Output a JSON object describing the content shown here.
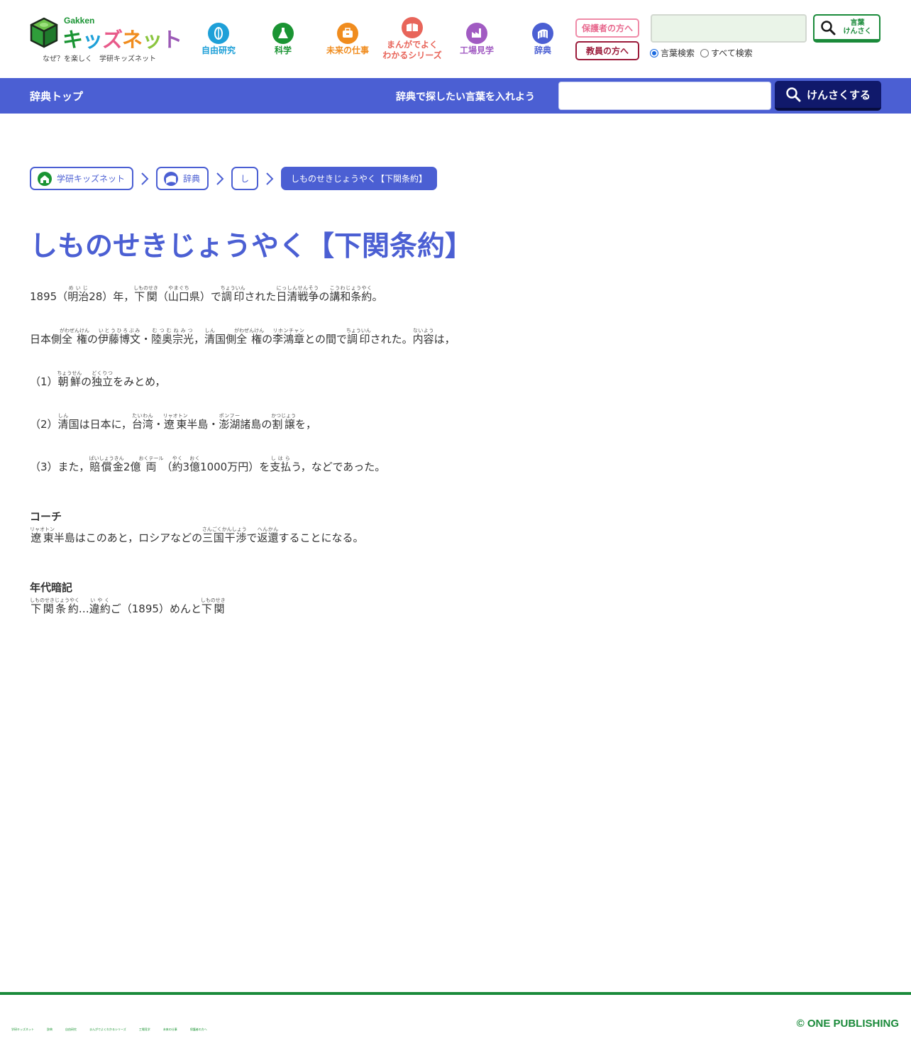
{
  "logo": {
    "brand": "Gakken",
    "name_parts": [
      "キ",
      "ッ",
      "ズ",
      "ネ",
      "ッ",
      "ト"
    ],
    "tagline": "なぜ？を楽しく　学研キッズネット"
  },
  "categories": [
    {
      "label": "自由研究",
      "icon": "magnifier-leaf-icon",
      "color": "#1ea0d8"
    },
    {
      "label": "科学",
      "icon": "flask-icon",
      "color": "#1a9433"
    },
    {
      "label": "未来の仕事",
      "icon": "briefcase-icon",
      "color": "#f08c1e"
    },
    {
      "label": "まんがでよく\nわかるシリーズ",
      "icon": "book-icon",
      "color": "#e8655a"
    },
    {
      "label": "工場見学",
      "icon": "factory-icon",
      "color": "#a15bc2"
    },
    {
      "label": "辞典",
      "icon": "dictionary-icon",
      "color": "#4b5fd3"
    }
  ],
  "header": {
    "parents_label": "保護者の方へ",
    "teachers_label": "教員の方へ",
    "search_value": "",
    "search_button_line1": "言葉",
    "search_button_line2": "けんさく",
    "radio_words": "言葉検索",
    "radio_all": "すべて検索",
    "radio_selected": "言葉検索"
  },
  "bar": {
    "home": "辞典トップ",
    "prompt": "辞典で探したい言葉を入れよう",
    "input_value": "",
    "button": "けんさくする"
  },
  "breadcrumb": [
    {
      "label": "学研キッズネット",
      "icon": "house-icon"
    },
    {
      "label": "辞典",
      "icon": "dictionary-icon"
    },
    {
      "label": "し",
      "icon": ""
    },
    {
      "label": "しものせきじょうやく【下関条約】",
      "icon": ""
    }
  ],
  "article": {
    "title": "しものせきじょうやく【下関条約】",
    "paragraphs": [
      "1895（明治28）年，下関（山口県）で調印された日清戦争の講和条約。",
      "日本側全権の伊藤博文・陸奥宗光，清国側全権の李鴻章との間で調印された。内容は，",
      "（1）朝鮮の独立をみとめ，",
      "（2）清国は日本に，台湾・遼東半島・澎湖諸島の割譲を，",
      "（3）また，賠償金2億両（約3億1000万円）を支払う，などであった。"
    ],
    "coach_heading": "コーチ",
    "coach_text": "遼東半島はこのあと，ロシアなどの三国干渉で返還することになる。",
    "mnemonic_heading": "年代暗記",
    "mnemonic_text": "下関条約…違約ご（1895）めんと下関"
  },
  "footer": {
    "links": [
      "学研キッズネット",
      "辞典",
      "自由研究",
      "まんがでよくわかるシリーズ",
      "工場見学",
      "未来の仕事",
      "保護者の方へ"
    ],
    "copyright": "© ONE PUBLISHING"
  }
}
